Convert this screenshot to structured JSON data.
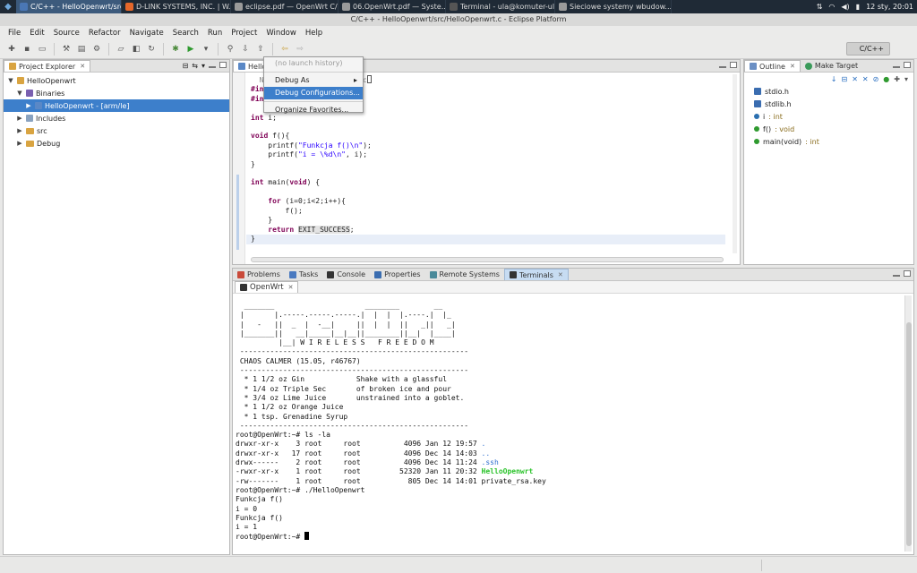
{
  "taskbar": {
    "tasks": [
      {
        "label": "C/C++ - HelloOpenwrt/src/...",
        "color": "#4a77b5"
      },
      {
        "label": "D-LINK SYSTEMS, INC. | W...",
        "color": "#e5672a"
      },
      {
        "label": "eclipse.pdf — OpenWrt C/...",
        "color": "#9a9a9a"
      },
      {
        "label": "06.OpenWrt.pdf — Syste...",
        "color": "#9a9a9a"
      },
      {
        "label": "Terminal - ula@komuter-ul...",
        "color": "#555555"
      },
      {
        "label": "Sieciowe systemy wbudow...",
        "color": "#9a9a9a"
      }
    ],
    "clock": "12 sty, 20:01"
  },
  "window_title": "C/C++ - HelloOpenwrt/src/HelloOpenwrt.c - Eclipse Platform",
  "menu": [
    "File",
    "Edit",
    "Source",
    "Refactor",
    "Navigate",
    "Search",
    "Run",
    "Project",
    "Window",
    "Help"
  ],
  "perspective": "C/C++",
  "project_explorer": {
    "tab_label": "Project Explorer",
    "items": [
      {
        "label": "HelloOpenwrt",
        "level": 0,
        "twisty": "▼",
        "icon": "project-icon"
      },
      {
        "label": "Binaries",
        "level": 1,
        "twisty": "▼",
        "icon": "binaries-icon"
      },
      {
        "label": "HelloOpenwrt - [arm/le]",
        "level": 2,
        "twisty": "▶",
        "icon": "binary-icon",
        "selected": true
      },
      {
        "label": "Includes",
        "level": 1,
        "twisty": "▶",
        "icon": "includes-icon"
      },
      {
        "label": "src",
        "level": 1,
        "twisty": "▶",
        "icon": "folder-icon"
      },
      {
        "label": "Debug",
        "level": 1,
        "twisty": "▶",
        "icon": "folder-icon"
      }
    ]
  },
  "editor": {
    "tab_label": "Hello",
    "header_line_end": "t.c"
  },
  "launch_menu": {
    "items": [
      {
        "label": "(no launch history)",
        "state": "disabled"
      },
      {
        "label": "Debug As",
        "state": "submenu"
      },
      {
        "label": "Debug Configurations...",
        "state": "highlighted"
      },
      {
        "label": "Organize Favorites...",
        "state": "normal"
      }
    ]
  },
  "outline": {
    "tab_label": "Outline",
    "tab2_label": "Make Target",
    "items": [
      {
        "label": "stdio.h",
        "type": "",
        "icon": "include-icon"
      },
      {
        "label": "stdlib.h",
        "type": "",
        "icon": "include-icon"
      },
      {
        "label": "i",
        "type": " : int",
        "icon": "variable-icon"
      },
      {
        "label": "f()",
        "type": " : void",
        "icon": "function-icon"
      },
      {
        "label": "main(void)",
        "type": " : int",
        "icon": "function-icon"
      }
    ]
  },
  "bottom_tabs": [
    "Problems",
    "Tasks",
    "Console",
    "Properties",
    "Remote Systems",
    "Terminals"
  ],
  "terminal": {
    "subtab": "OpenWrt",
    "banner": [
      "  _______                     ________        __",
      " |       |.-----.-----.-----.|  |  |  |.----.|  |_",
      " |   -   ||  _  |  -__|     ||  |  |  ||   _||   _|",
      " |_______||   __|_____|__|__||________||__|  |____|",
      "          |__| W I R E L E S S   F R E E D O M",
      " -----------------------------------------------------",
      " CHAOS CALMER (15.05, r46767)",
      " -----------------------------------------------------",
      "  * 1 1/2 oz Gin            Shake with a glassful",
      "  * 1/4 oz Triple Sec       of broken ice and pour",
      "  * 3/4 oz Lime Juice       unstrained into a goblet.",
      "  * 1 1/2 oz Orange Juice",
      "  * 1 tsp. Grenadine Syrup",
      " -----------------------------------------------------",
      "root@OpenWrt:~# ls -la"
    ],
    "listing": [
      {
        "perm": "drwxr-xr-x    3 root     root          4096 Jan 12 19:57 ",
        "name": ".",
        "kind": "dir"
      },
      {
        "perm": "drwxr-xr-x   17 root     root          4096 Dec 14 14:03 ",
        "name": "..",
        "kind": "dir"
      },
      {
        "perm": "drwx------    2 root     root          4096 Dec 14 11:24 ",
        "name": ".ssh",
        "kind": "dir"
      },
      {
        "perm": "-rwxr-xr-x    1 root     root         52320 Jan 11 20:32 ",
        "name": "HelloOpenwrt",
        "kind": "exec"
      },
      {
        "perm": "-rw-------    1 root     root           805 Dec 14 14:01 ",
        "name": "private_rsa.key",
        "kind": "file"
      }
    ],
    "after": [
      "root@OpenWrt:~# ./HelloOpenwrt",
      "Funkcja f()",
      "i = 0",
      "Funkcja f()",
      "i = 1"
    ],
    "prompt": "root@OpenWrt:~# "
  }
}
